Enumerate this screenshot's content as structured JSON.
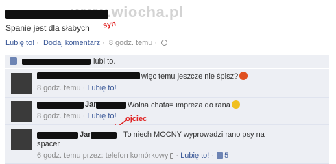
{
  "watermark": "www.wiocha.pl",
  "post": {
    "status_text": "Spanie jest dla słabych",
    "note_syn": "syn",
    "actions": {
      "like": "Lubię to!",
      "comment": "Dodaj komentarz",
      "time": "8 godz. temu"
    }
  },
  "likes": {
    "text": "lubi to."
  },
  "comments": [
    {
      "text": "więc temu jeszcze nie śpisz?",
      "emoticon": "devil-icon",
      "time": "8 godz. temu",
      "like": "Lubię to!"
    },
    {
      "name_fragment": "Jan",
      "text": "Wolna chata= impreza do rana",
      "emoticon": "smile-icon",
      "time": "8 godz. temu",
      "like": "Lubię to!"
    },
    {
      "name_fragment": "Jan",
      "text": "To niech MOCNY wyprowadzi rano psy na",
      "text_line2": "spacer",
      "time": "6 godz. temu przez: telefon komórkowy",
      "like": "Lubię to!",
      "like_count": "5"
    }
  ],
  "annotations": {
    "ojciec": "ojciec"
  },
  "colors": {
    "link_blue": "#3b5998",
    "meta_grey": "#8b8b8b",
    "comment_bg": "#edeff4",
    "annotation_red": "#e02020"
  }
}
